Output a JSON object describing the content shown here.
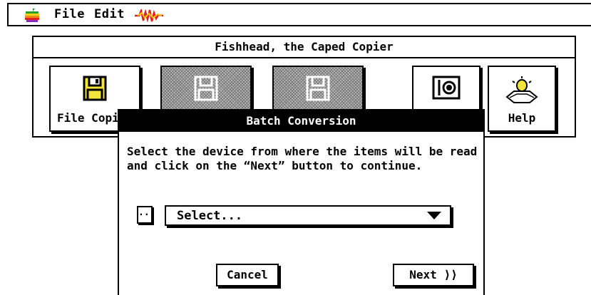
{
  "menubar": {
    "file_label": "File",
    "edit_label": "Edit"
  },
  "window": {
    "title": "Fishhead, the Caped Copier",
    "tools": [
      {
        "label": "File Copier",
        "icon": "floppy-disk-icon",
        "enabled": true
      },
      {
        "label": "",
        "icon": "floppy-disk-icon",
        "enabled": false
      },
      {
        "label": "",
        "icon": "floppy-disk-icon",
        "enabled": false
      },
      {
        "label": "",
        "icon": "disk-drive-icon",
        "enabled": true
      },
      {
        "label": "Help",
        "icon": "lightbulb-help-icon",
        "enabled": true
      }
    ]
  },
  "dialog": {
    "title": "Batch Conversion",
    "instructions": "Select the device from where the items will be read and click on the “Next” button to continue.",
    "browse_label": "...",
    "select_value": "Select...",
    "cancel_label": "Cancel",
    "next_label": "Next ⟩⟩"
  },
  "colors": {
    "foreground": "#000000",
    "background": "#ffffff",
    "disabled_pattern": "#777777"
  }
}
